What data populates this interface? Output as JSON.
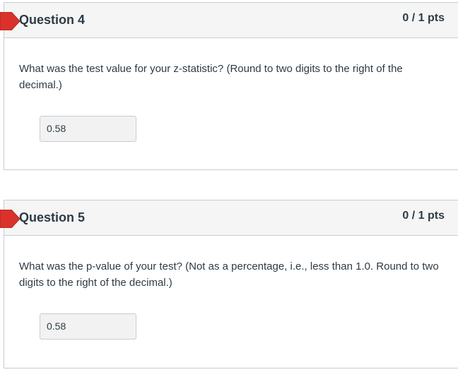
{
  "questions": [
    {
      "title": "Question 4",
      "points": "0 / 1 pts",
      "text": "What was the test value for your z-statistic? (Round to two digits to the right of the decimal.)",
      "answer": "0.58"
    },
    {
      "title": "Question 5",
      "points": "0 / 1 pts",
      "text": "What was the p-value of your test? (Not as a percentage, i.e., less than 1.0. Round to two digits to the right of the decimal.)",
      "answer": "0.58"
    }
  ],
  "colors": {
    "flag": "#d9312b",
    "header_bg": "#f5f5f5",
    "border": "#c7cdd1",
    "answer_bg": "#f2f2f2",
    "text": "#2d3b45"
  },
  "icons": {
    "flag": "incorrect-flag-icon"
  }
}
